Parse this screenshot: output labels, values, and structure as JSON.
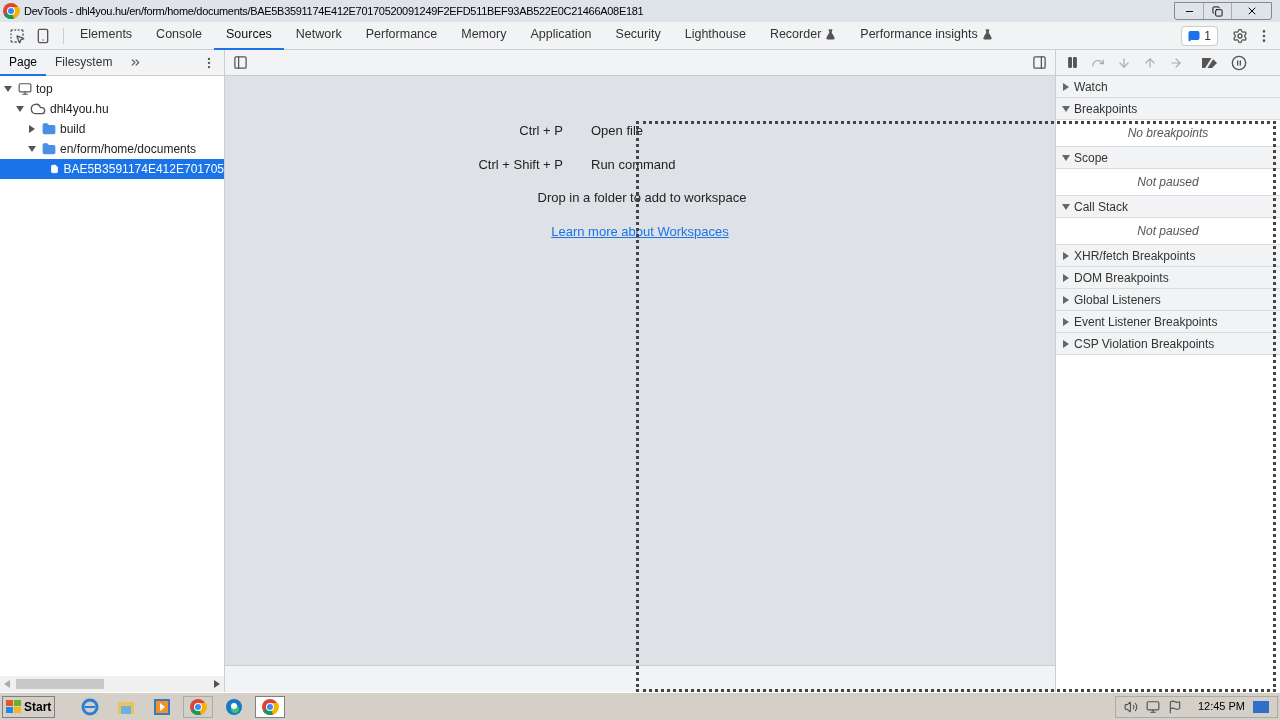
{
  "window": {
    "title": "DevTools - dhl4you.hu/en/form/home/documents/BAE5B3591174E412E70170520091249F2EFD511BEF93AB522E0C21466A08E181"
  },
  "tabs": [
    {
      "label": "Elements",
      "selected": false,
      "experimental": false
    },
    {
      "label": "Console",
      "selected": false,
      "experimental": false
    },
    {
      "label": "Sources",
      "selected": true,
      "experimental": false
    },
    {
      "label": "Network",
      "selected": false,
      "experimental": false
    },
    {
      "label": "Performance",
      "selected": false,
      "experimental": false
    },
    {
      "label": "Memory",
      "selected": false,
      "experimental": false
    },
    {
      "label": "Application",
      "selected": false,
      "experimental": false
    },
    {
      "label": "Security",
      "selected": false,
      "experimental": false
    },
    {
      "label": "Lighthouse",
      "selected": false,
      "experimental": false
    },
    {
      "label": "Recorder",
      "selected": false,
      "experimental": true
    },
    {
      "label": "Performance insights",
      "selected": false,
      "experimental": true
    }
  ],
  "issues_count": "1",
  "navigator": {
    "tabs": [
      {
        "label": "Page",
        "selected": true
      },
      {
        "label": "Filesystem",
        "selected": false
      }
    ],
    "tree": [
      {
        "kind": "frame",
        "label": "top",
        "expanded": true,
        "selected": false,
        "children": [
          {
            "kind": "domain",
            "label": "dhl4you.hu",
            "expanded": true,
            "selected": false,
            "children": [
              {
                "kind": "folder",
                "label": "build",
                "expanded": false,
                "selected": false
              },
              {
                "kind": "folder",
                "label": "en/form/home/documents",
                "expanded": true,
                "selected": false,
                "children": [
                  {
                    "kind": "file",
                    "label": "BAE5B3591174E412E701705",
                    "selected": true
                  }
                ]
              }
            ]
          }
        ]
      }
    ]
  },
  "editor": {
    "shortcuts": [
      {
        "keys": "Ctrl + P",
        "action": "Open file"
      },
      {
        "keys": "Ctrl + Shift + P",
        "action": "Run command"
      }
    ],
    "drop_hint": "Drop in a folder to add to workspace",
    "link": "Learn more about Workspaces"
  },
  "debugger": {
    "sections": [
      {
        "label": "Watch",
        "expanded": false
      },
      {
        "label": "Breakpoints",
        "expanded": true,
        "body": "No breakpoints"
      },
      {
        "label": "Scope",
        "expanded": true,
        "body": "Not paused"
      },
      {
        "label": "Call Stack",
        "expanded": true,
        "body": "Not paused"
      },
      {
        "label": "XHR/fetch Breakpoints",
        "expanded": false
      },
      {
        "label": "DOM Breakpoints",
        "expanded": false
      },
      {
        "label": "Global Listeners",
        "expanded": false
      },
      {
        "label": "Event Listener Breakpoints",
        "expanded": false
      },
      {
        "label": "CSP Violation Breakpoints",
        "expanded": false
      }
    ]
  },
  "taskbar": {
    "start": "Start",
    "apps": [
      {
        "kind": "ie",
        "active": false
      },
      {
        "kind": "explorer",
        "active": false
      },
      {
        "kind": "media",
        "active": false
      },
      {
        "kind": "chrome",
        "active": false
      },
      {
        "kind": "edge",
        "active": false
      },
      {
        "kind": "chrome",
        "active": true
      }
    ],
    "time": "12:45 PM"
  }
}
